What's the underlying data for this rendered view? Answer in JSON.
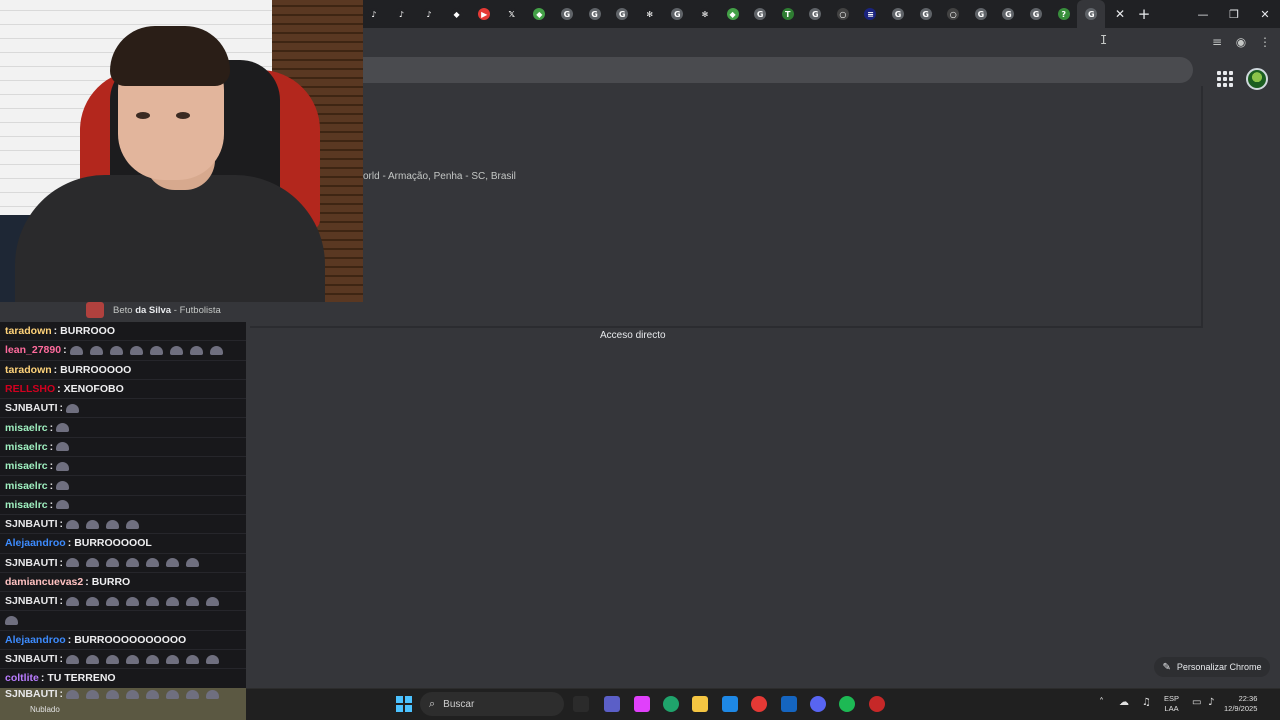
{
  "browser": {
    "tabs": [
      {
        "icon": "tiktok-icon",
        "glyph": "♪",
        "color": "#202124"
      },
      {
        "icon": "tiktok-icon",
        "glyph": "♪",
        "color": "#202124"
      },
      {
        "icon": "tiktok-icon",
        "glyph": "♪",
        "color": "#202124"
      },
      {
        "icon": "kick-icon",
        "glyph": "◆",
        "color": "#202124"
      },
      {
        "icon": "youtube-icon",
        "glyph": "▶",
        "color": "#e53935"
      },
      {
        "icon": "x-icon",
        "glyph": "𝕏",
        "color": "#202124"
      },
      {
        "icon": "shield-icon",
        "glyph": "◆",
        "color": "#43a047"
      },
      {
        "icon": "google-icon",
        "glyph": "G",
        "color": "#5f6368"
      },
      {
        "icon": "google-icon",
        "glyph": "G",
        "color": "#5f6368"
      },
      {
        "icon": "google-icon",
        "glyph": "G",
        "color": "#5f6368"
      },
      {
        "icon": "openai-icon",
        "glyph": "✻",
        "color": "#202124"
      },
      {
        "icon": "google-icon",
        "glyph": "G",
        "color": "#5f6368"
      },
      {
        "icon": "openai-icon",
        "glyph": "✻",
        "color": "#202124"
      },
      {
        "icon": "shield-icon",
        "glyph": "◆",
        "color": "#43a047"
      },
      {
        "icon": "google-icon",
        "glyph": "G",
        "color": "#5f6368"
      },
      {
        "icon": "transfermarkt-icon",
        "glyph": "T",
        "color": "#2e7d32"
      },
      {
        "icon": "google-icon",
        "glyph": "G",
        "color": "#5f6368"
      },
      {
        "icon": "globe-icon",
        "glyph": "○",
        "color": "#424242"
      },
      {
        "icon": "site-icon",
        "glyph": "≡",
        "color": "#1a237e"
      },
      {
        "icon": "google-icon",
        "glyph": "G",
        "color": "#5f6368"
      },
      {
        "icon": "google-icon",
        "glyph": "G",
        "color": "#5f6368"
      },
      {
        "icon": "globe-icon",
        "glyph": "○",
        "color": "#424242"
      },
      {
        "icon": "google-icon",
        "glyph": "G",
        "color": "#5f6368"
      },
      {
        "icon": "google-icon",
        "glyph": "G",
        "color": "#5f6368"
      },
      {
        "icon": "google-icon",
        "glyph": "G",
        "color": "#5f6368"
      },
      {
        "icon": "question-icon",
        "glyph": "?",
        "color": "#388e3c"
      },
      {
        "icon": "google-icon",
        "glyph": "G",
        "color": "#5f6368"
      }
    ],
    "close_tab": "✕",
    "new_tab": "+",
    "minimize": "—",
    "restore": "❐",
    "close_window": "✕"
  },
  "page": {
    "location_text": "orld - Armação, Penha - SC, Brasil",
    "shortcut_label": "Acceso directo",
    "customize_label": "Personalizar Chrome",
    "customize_icon": "✎"
  },
  "stream": {
    "streamer_name": "Beto",
    "streamer_name_bold": "da Silva",
    "streamer_role": "Futbolista"
  },
  "chat": {
    "messages": [
      {
        "user": "taradown",
        "color": "#ffd37a",
        "text": "BURROOO",
        "emotes": 0
      },
      {
        "user": "lean_27890",
        "color": "#ff6b9d",
        "text": "",
        "emotes": 8
      },
      {
        "user": "taradown",
        "color": "#ffd37a",
        "text": "BURROOOOO",
        "emotes": 0
      },
      {
        "user": "RELLSHO",
        "color": "#d1001f",
        "text": "XENOFOBO",
        "emotes": 0
      },
      {
        "user": "SJNBAUTI",
        "color": "#e8e8ea",
        "text": "",
        "emotes": 1
      },
      {
        "user": "misaelrc",
        "color": "#9ff0c0",
        "text": "",
        "emotes": 1
      },
      {
        "user": "misaelrc",
        "color": "#9ff0c0",
        "text": "",
        "emotes": 1
      },
      {
        "user": "misaelrc",
        "color": "#9ff0c0",
        "text": "",
        "emotes": 1
      },
      {
        "user": "misaelrc",
        "color": "#9ff0c0",
        "text": "",
        "emotes": 1
      },
      {
        "user": "misaelrc",
        "color": "#9ff0c0",
        "text": "",
        "emotes": 1
      },
      {
        "user": "SJNBAUTI",
        "color": "#e8e8ea",
        "text": "",
        "emotes": 4
      },
      {
        "user": "Alejaandroo",
        "color": "#3d8bfd",
        "text": "BURROOOOOL",
        "emotes": 0
      },
      {
        "user": "SJNBAUTI",
        "color": "#e8e8ea",
        "text": "",
        "emotes": 7
      },
      {
        "user": "damiancuevas2",
        "color": "#ffc2c2",
        "text": "BURRO",
        "emotes": 0
      },
      {
        "user": "SJNBAUTI",
        "color": "#e8e8ea",
        "text": "",
        "emotes": 8
      },
      {
        "user": "",
        "color": "#e8e8ea",
        "text": "",
        "emotes": 1
      },
      {
        "user": "Alejaandroo",
        "color": "#3d8bfd",
        "text": "BURROOOOOOOOOO",
        "emotes": 0
      },
      {
        "user": "SJNBAUTI",
        "color": "#e8e8ea",
        "text": "",
        "emotes": 8
      },
      {
        "user": "coltlite",
        "color": "#b97cff",
        "text": "TU TERRENO",
        "emotes": 0
      }
    ],
    "overlay_last": {
      "user": "SJNBAUTI",
      "color": "#e8e8ea",
      "emotes": 8
    }
  },
  "taskbar": {
    "weather_label": "Nublado",
    "search_placeholder": "Buscar",
    "search_icon": "⌕",
    "lang_line1": "ESP",
    "lang_line2": "LAA",
    "time": "22:36",
    "date": "12/9/2025",
    "apps": [
      {
        "icon": "file-explorer-icon",
        "color": "#2b2b2b"
      },
      {
        "icon": "teams-icon",
        "color": "#5b5fc7"
      },
      {
        "icon": "copilot-icon",
        "color": "#e040fb"
      },
      {
        "icon": "edge-icon",
        "color": "#1fa36b"
      },
      {
        "icon": "folder-icon",
        "color": "#f4c542"
      },
      {
        "icon": "store-icon",
        "color": "#1e88e5"
      },
      {
        "icon": "chrome-icon",
        "color": "#e53935"
      },
      {
        "icon": "outlook-icon",
        "color": "#1565c0"
      },
      {
        "icon": "discord-icon",
        "color": "#5865f2"
      },
      {
        "icon": "spotify-icon",
        "color": "#1db954"
      },
      {
        "icon": "app-icon",
        "color": "#c62828"
      }
    ]
  }
}
